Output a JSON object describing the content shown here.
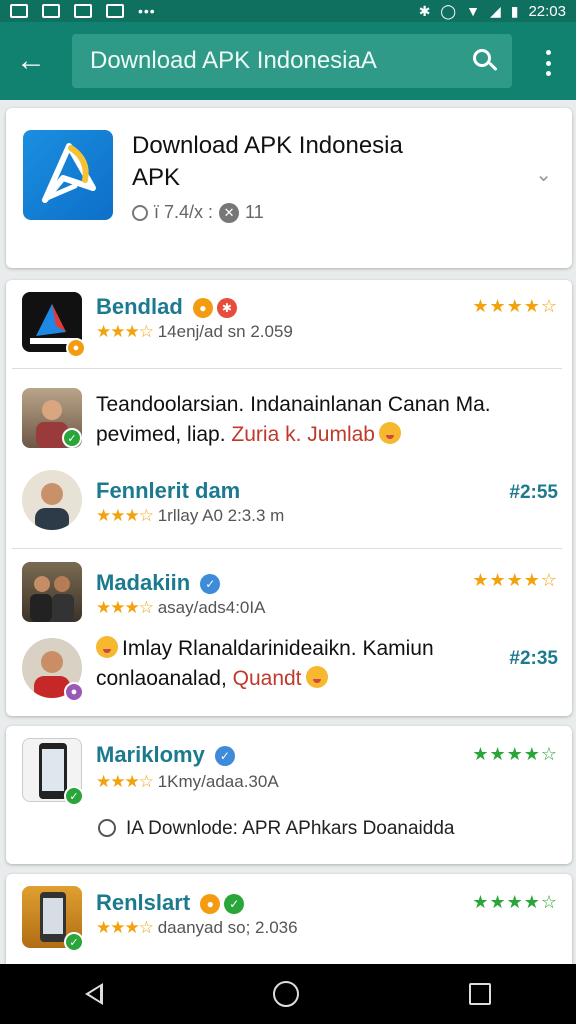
{
  "status_bar": {
    "time": "22:03",
    "colors": {
      "bg": "#10705f"
    }
  },
  "app_bar": {
    "search_text": "Download APK IndonesiaA",
    "back_icon": "arrow-left-icon",
    "search_icon": "search-icon",
    "more_icon": "more-vert-icon",
    "colors": {
      "bg": "#128270",
      "search_bg": "#2e9a87"
    }
  },
  "app_card": {
    "title_line1": "Download APK Indonesia",
    "title_line2": "APK",
    "meta_left": "ї 7.4/х :",
    "meta_right": "11"
  },
  "reviews": [
    {
      "name": "Bendlad",
      "sub": "14enj/ad sn 2.059",
      "stars": "★★★★☆",
      "type": "header"
    },
    {
      "body_line1": "Teandoolarsian. Indanainlanan Canan Ma.",
      "body_line2_a": "pevimed, liap.",
      "body_line2_red": "Zuria k. Jumlab",
      "type": "comment"
    },
    {
      "name": "Fennlerit dam",
      "sub": "1rllay A0 2:3.3 m",
      "time": "#2:55",
      "type": "header"
    },
    {
      "name": "Madakiin",
      "sub": "asay/ads4:0IA",
      "stars": "★★★★☆",
      "type": "header"
    },
    {
      "body_line1": "Imlay Rlanaldarinideaikn. Kamiun",
      "body_line2_a": "conlaoanalad,",
      "body_line2_red": "Quandt",
      "time": "#2:35",
      "type": "comment"
    },
    {
      "name": "Mariklomy",
      "sub": "1Kmy/adaa.30A",
      "stars": "★★★★☆",
      "quote": "IA Downlode: APR APhkars Doanaidda",
      "type": "header"
    },
    {
      "name": "Renlslart",
      "sub": "daanyad so; 2.036",
      "stars": "★★★★☆",
      "type": "header"
    }
  ],
  "sub_star_glyphs": "★★★☆",
  "accent_colors": {
    "name": "#1c7a8f",
    "star": "#f2a20c",
    "star_green": "#2aa53a",
    "red_text": "#c0392b"
  },
  "nav_bar": {
    "back_icon": "nav-back-icon",
    "home_icon": "nav-home-icon",
    "recents_icon": "nav-recents-icon"
  }
}
